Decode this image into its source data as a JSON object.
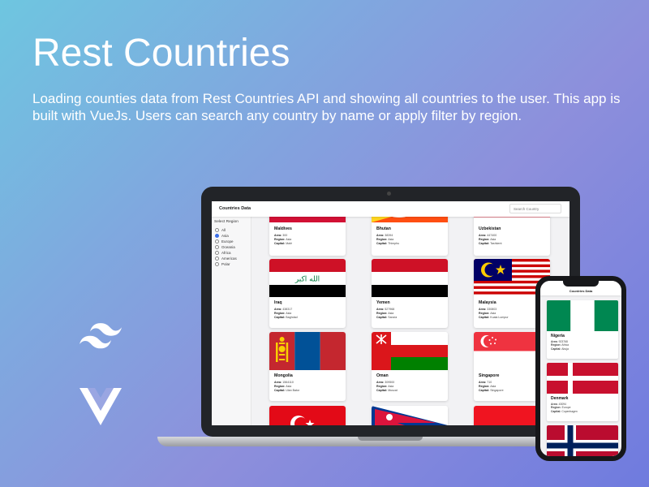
{
  "hero": {
    "title": "Rest Countries",
    "description": "Loading counties data from Rest Countries API and showing all countries to the user. This app is built with VueJs. Users can search any country by name or apply filter by region."
  },
  "logos": [
    "tailwind-logo",
    "vue-logo"
  ],
  "app": {
    "brand": "Countries Data",
    "search_placeholder": "Search Country",
    "sidebar_title": "Select Region",
    "regions": [
      {
        "label": "All",
        "selected": false
      },
      {
        "label": "Asia",
        "selected": true
      },
      {
        "label": "Europe",
        "selected": false
      },
      {
        "label": "Oceania",
        "selected": false
      },
      {
        "label": "Africa",
        "selected": false
      },
      {
        "label": "Americas",
        "selected": false
      },
      {
        "label": "Polar",
        "selected": false
      }
    ],
    "field_labels": {
      "area": "Area:",
      "region": "Region:",
      "capital": "Capital:"
    },
    "countries": [
      {
        "name": "Maldives",
        "area": "300",
        "region": "Asia",
        "capital": "Malé"
      },
      {
        "name": "Bhutan",
        "area": "38394",
        "region": "Asia",
        "capital": "Thimphu"
      },
      {
        "name": "Uzbekistan",
        "area": "447400",
        "region": "Asia",
        "capital": "Tashkent"
      },
      {
        "name": "Iraq",
        "area": "438317",
        "region": "Asia",
        "capital": "Baghdad",
        "flag_script": "الله اكبر"
      },
      {
        "name": "Yemen",
        "area": "527968",
        "region": "Asia",
        "capital": "Sana'a"
      },
      {
        "name": "Malaysia",
        "area": "330803",
        "region": "Asia",
        "capital": "Kuala Lumpur"
      },
      {
        "name": "Mongolia",
        "area": "1564110",
        "region": "Asia",
        "capital": "Ulan Bator"
      },
      {
        "name": "Oman",
        "area": "309500",
        "region": "Asia",
        "capital": "Muscat"
      },
      {
        "name": "Singapore",
        "area": "710",
        "region": "Asia",
        "capital": "Singapore"
      }
    ]
  },
  "phone": {
    "title": "Countries Data",
    "countries": [
      {
        "name": "Nigeria",
        "area": "923768",
        "region": "Africa",
        "capital": "Abuja"
      },
      {
        "name": "Denmark",
        "area": "43094",
        "region": "Europe",
        "capital": "Copenhagen"
      }
    ]
  },
  "colors": {
    "accent": "#3b6ee8",
    "background_start": "#6ec6e0",
    "background_end": "#6f7bde"
  }
}
